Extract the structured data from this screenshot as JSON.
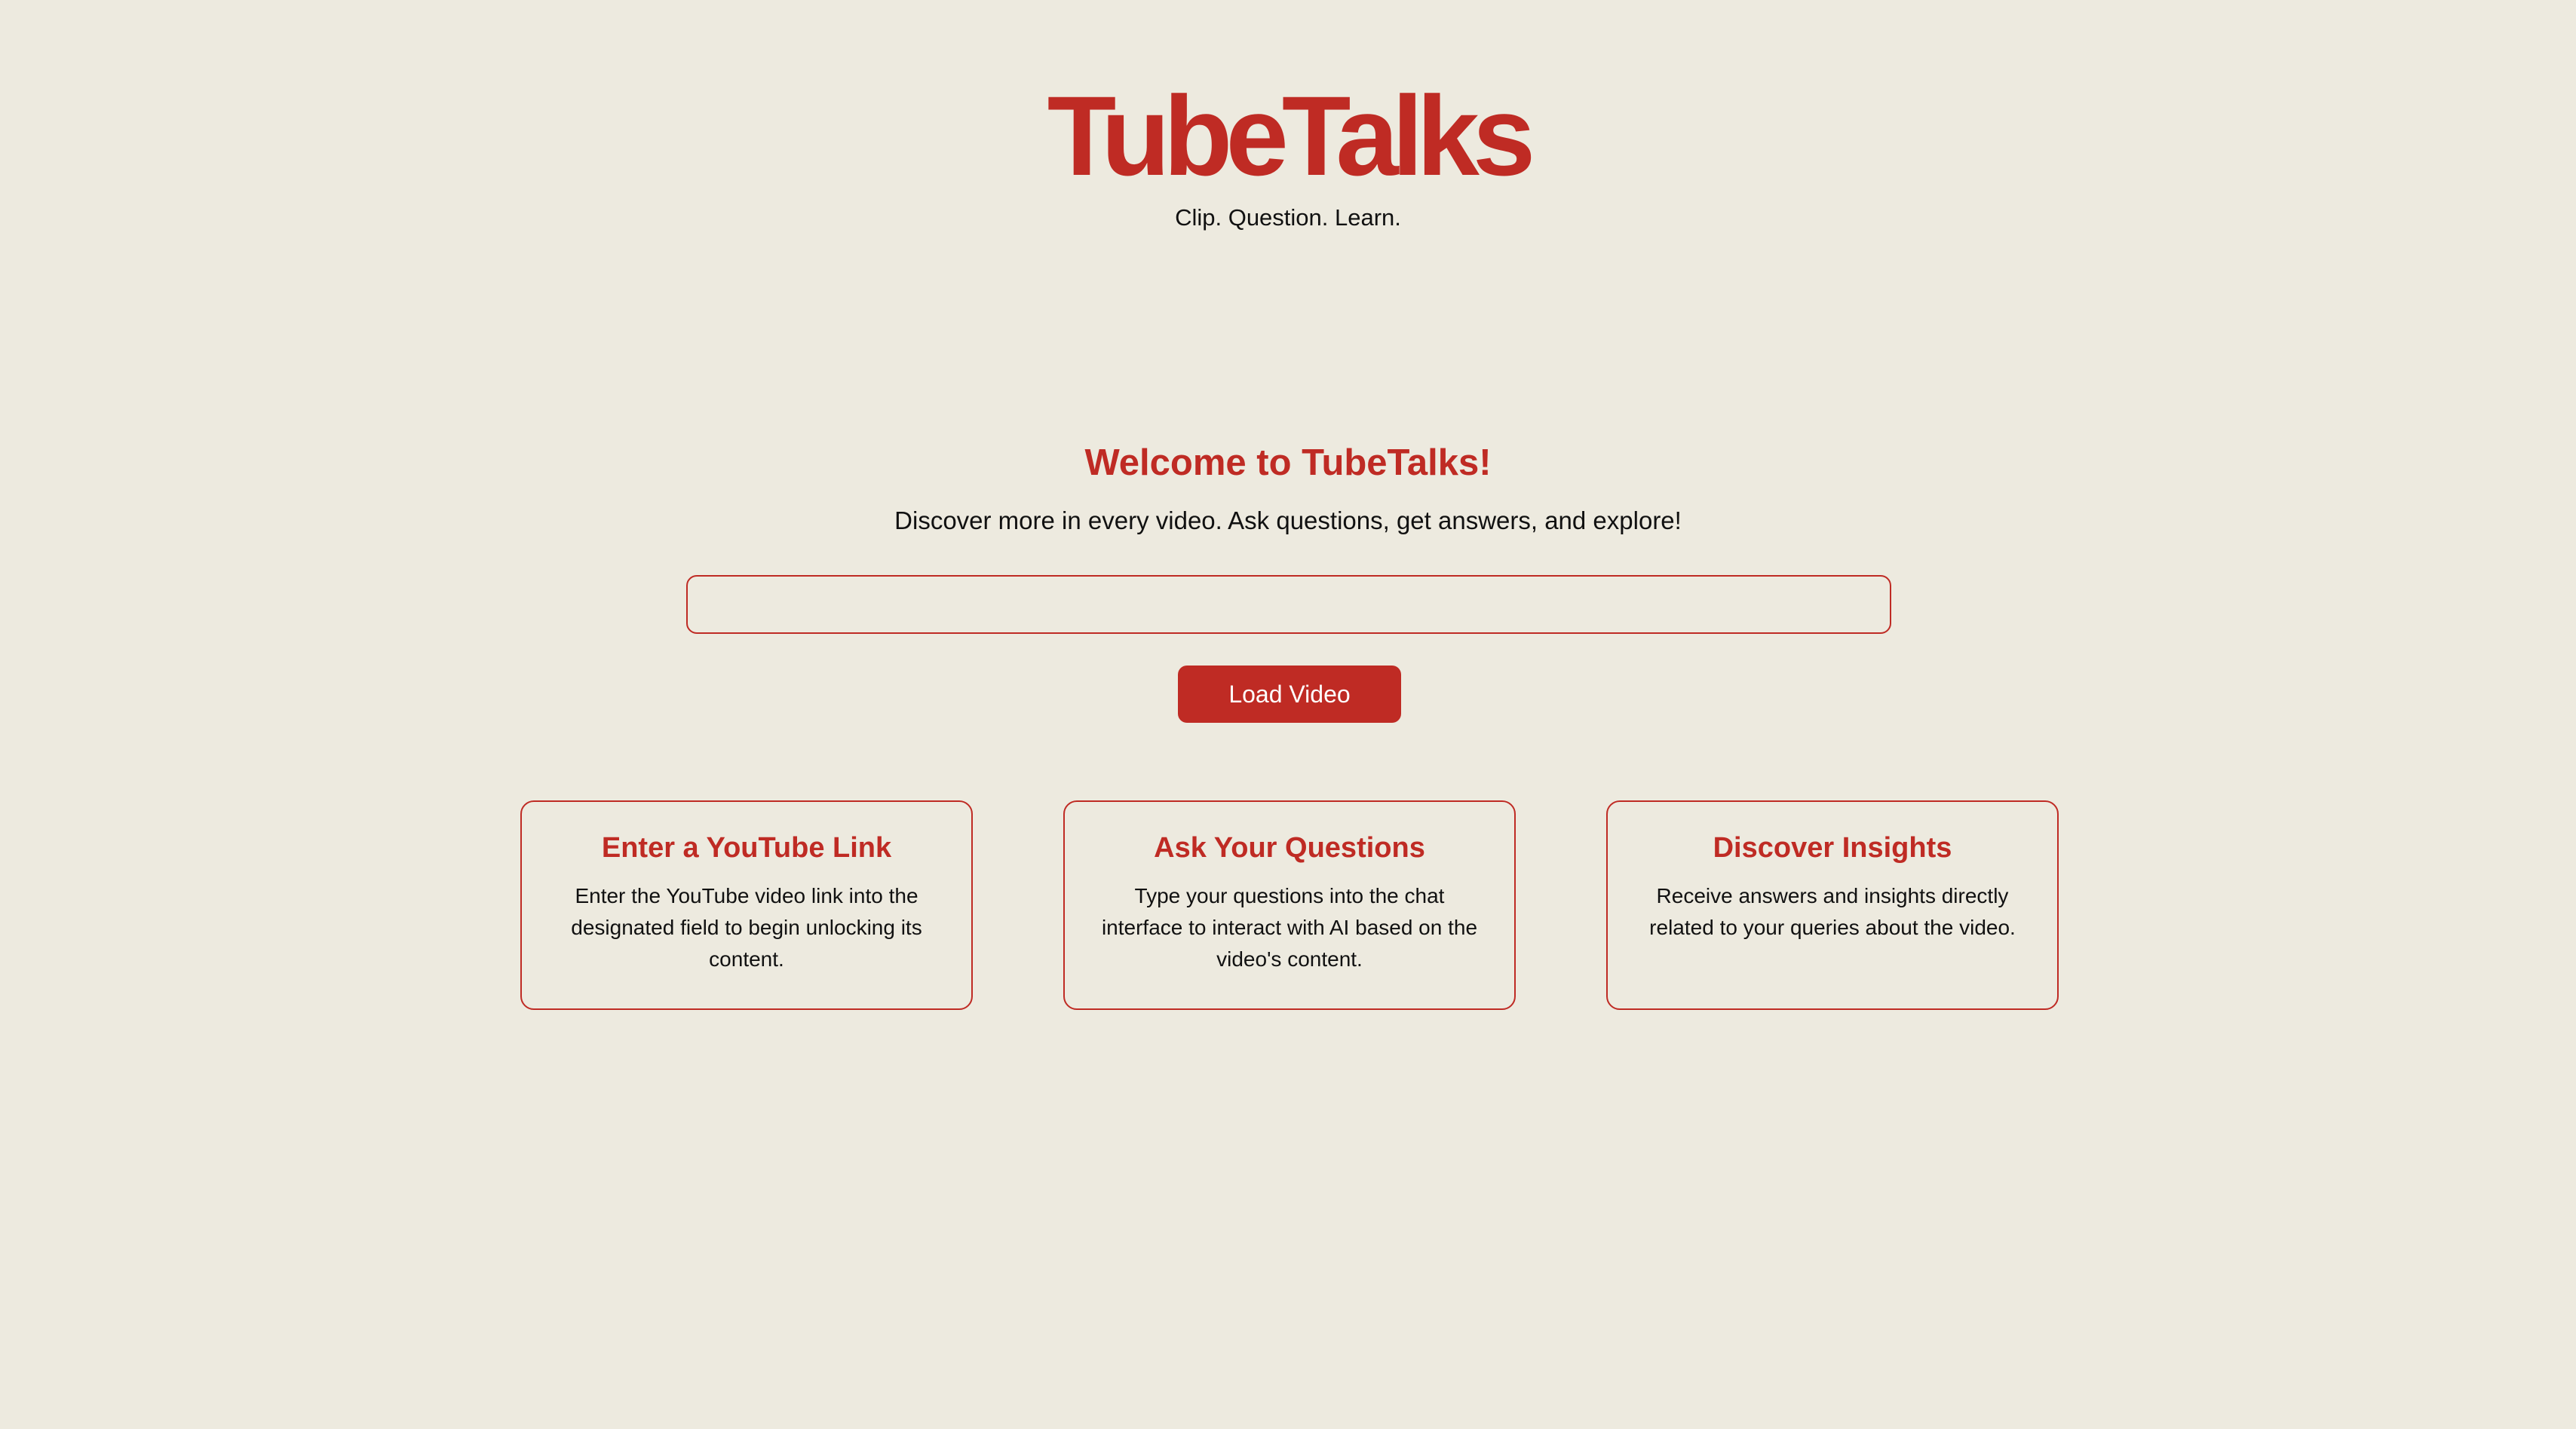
{
  "header": {
    "logo_text": "TubeTalks",
    "tagline": "Clip. Question. Learn."
  },
  "welcome": {
    "title": "Welcome to TubeTalks!",
    "subtitle": "Discover more in every video. Ask questions, get answers, and explore!"
  },
  "video_input": {
    "value": "",
    "placeholder": ""
  },
  "load_button": {
    "label": "Load Video"
  },
  "features": [
    {
      "title": "Enter a YouTube Link",
      "text": "Enter the YouTube video link into the designated field to begin unlocking its content."
    },
    {
      "title": "Ask Your Questions",
      "text": "Type your questions into the chat interface to interact with AI based on the video's content."
    },
    {
      "title": "Discover Insights",
      "text": "Receive answers and insights directly related to your queries about the video."
    }
  ],
  "colors": {
    "background": "#edeadf",
    "accent": "#bf2b24",
    "text": "#111111",
    "button_text": "#ffffff"
  }
}
